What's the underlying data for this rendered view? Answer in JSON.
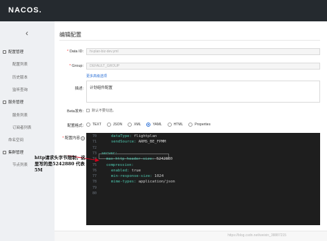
{
  "header": {
    "logo": "NACOS."
  },
  "sidebar": {
    "collapse_glyph": "‹",
    "groups": [
      {
        "label": "配置管理",
        "items": [
          "配置列表",
          "历史版本",
          "监听查询"
        ]
      },
      {
        "label": "服务管理",
        "items": [
          "服务列表",
          "订阅者列表"
        ]
      },
      {
        "label": "命名空间",
        "items": []
      },
      {
        "label": "集群管理",
        "items": [
          "节点列表"
        ]
      }
    ]
  },
  "form": {
    "title": "编辑配置",
    "data_id": {
      "label": "Data ID:",
      "value": "hi-plan-biz-dev.yml"
    },
    "group": {
      "label": "Group:",
      "value": "DEFAULT_GROUP"
    },
    "advanced_link": "更多高级选项",
    "description": {
      "label": "描述:",
      "value": "计划组件配置"
    },
    "beta": {
      "label": "Beta发布:",
      "option": "默认不要勾选。"
    },
    "format": {
      "label": "配置格式:",
      "options": [
        "TEXT",
        "JSON",
        "XML",
        "YAML",
        "HTML",
        "Properties"
      ],
      "selected": "YAML"
    },
    "content_label": "配置内容",
    "help_glyph": "?"
  },
  "editor": {
    "lines": [
      {
        "n": "70",
        "indent": 2,
        "key": "dataType:",
        "val": " flightplan"
      },
      {
        "n": "71",
        "indent": 2,
        "key": "sendSource:",
        "val": " ARMS_BE_FPMM"
      },
      {
        "n": "72",
        "indent": 0,
        "key": "",
        "val": ""
      },
      {
        "n": "73",
        "indent": 0,
        "key": "server:",
        "val": ""
      },
      {
        "n": "74",
        "indent": 1,
        "key": "max-http-header-size:",
        "val": " 5242880"
      },
      {
        "n": "75",
        "indent": 1,
        "key": "compression:",
        "val": ""
      },
      {
        "n": "76",
        "indent": 2,
        "key": "enabled:",
        "val": " true"
      },
      {
        "n": "77",
        "indent": 2,
        "key": "min-response-size:",
        "val": " 1024"
      },
      {
        "n": "78",
        "indent": 2,
        "key": "mime-types:",
        "val": " application/json"
      },
      {
        "n": "79",
        "indent": 0,
        "key": "",
        "val": ""
      },
      {
        "n": "80",
        "indent": 0,
        "key": "",
        "val": ""
      }
    ]
  },
  "annotation": {
    "text": "http请求头字节限制，这里写的是5242880 代表5M",
    "arrow_color": "#d0021b"
  },
  "watermark": "https://blog.csdn.net/weixin_38887215",
  "colors": {
    "accent": "#2a6fd6",
    "header_bg": "#252a2f",
    "editor_bg": "#1e1e1e",
    "yaml_key": "#4ec9b0"
  }
}
